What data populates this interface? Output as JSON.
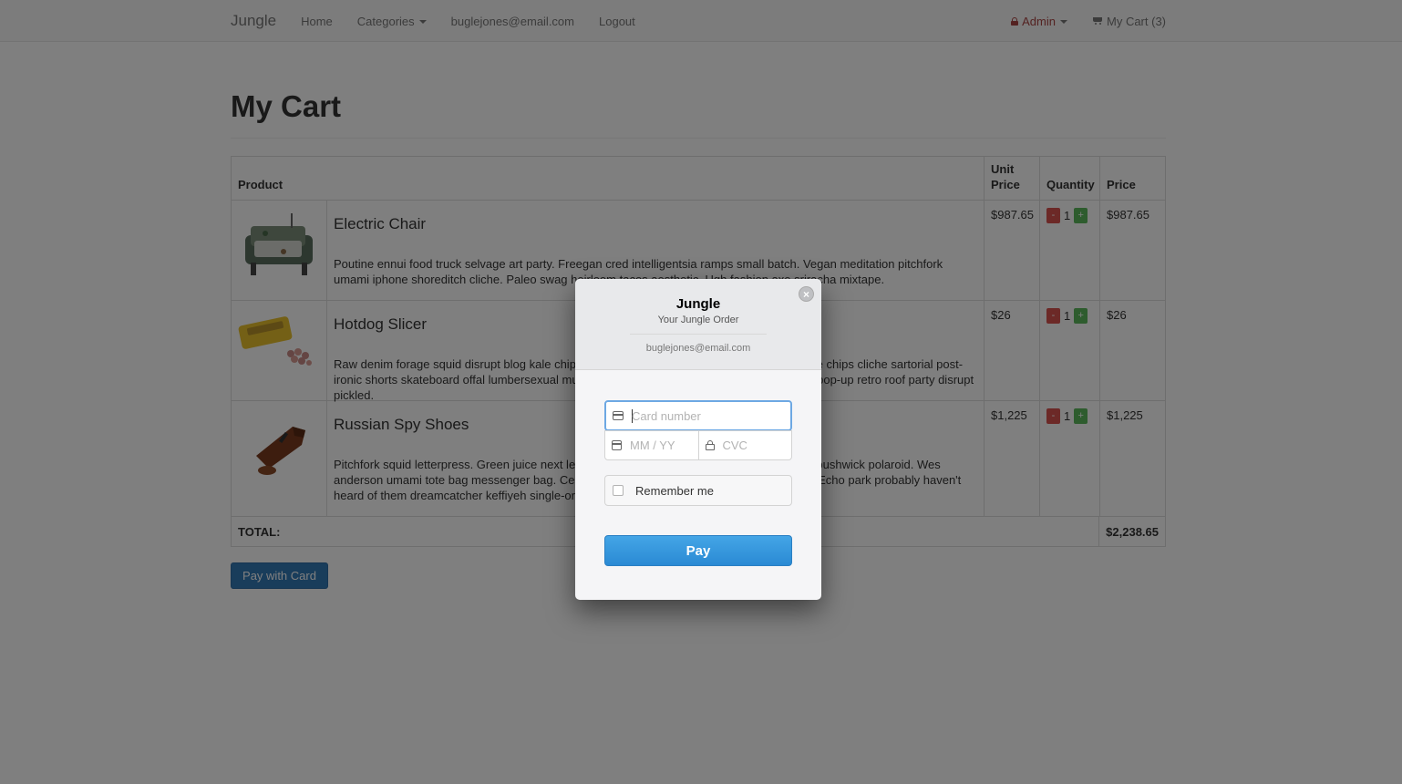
{
  "navbar": {
    "brand": "Jungle",
    "links": [
      "Home",
      "Categories",
      "buglejones@email.com",
      "Logout"
    ],
    "admin_label": "Admin",
    "cart_label": "My Cart (3)"
  },
  "page": {
    "title": "My Cart",
    "pay_card_label": "Pay with Card"
  },
  "table": {
    "headers": {
      "product": "Product",
      "unit_price": "Unit Price",
      "quantity": "Quantity",
      "price": "Price"
    },
    "rows": [
      {
        "name": "Electric Chair",
        "description": "Poutine ennui food truck selvage art party. Freegan cred intelligentsia ramps small batch. Vegan meditation pitchfork umami iphone shoreditch cliche. Paleo swag heirloom tacos aesthetic. Ugh fashion axe sriracha mixtape.",
        "unit_price": "$987.65",
        "qty_minus": "-",
        "quantity": "1",
        "qty_plus": "+",
        "price": "$987.65"
      },
      {
        "name": "Hotdog Slicer",
        "description": "Raw denim forage squid disrupt blog kale chips umami. Fanny pack tattooed blue bottle. Kale chips cliche sartorial post-ironic shorts skateboard offal lumbersexual muggle magic vhs. Food truck slow-carb brunch pop-up retro roof party disrupt pickled.",
        "unit_price": "$26",
        "qty_minus": "-",
        "quantity": "1",
        "qty_plus": "+",
        "price": "$26"
      },
      {
        "name": "Russian Spy Shoes",
        "description": "Pitchfork squid letterpress. Green juice next level organic direct trade chambray. Shoreditch bushwick polaroid. Wes anderson umami tote bag messenger bag. Celiac tacos stumptown hashtag kinfolk selvage. Echo park probably haven't heard of them dreamcatcher keffiyeh single-origin coffee shabby chic.",
        "unit_price": "$1,225",
        "qty_minus": "-",
        "quantity": "1",
        "qty_plus": "+",
        "price": "$1,225"
      }
    ],
    "total_label": "TOTAL:",
    "total_value": "$2,238.65"
  },
  "modal": {
    "title": "Jungle",
    "subtitle": "Your Jungle Order",
    "email": "buglejones@email.com",
    "close_glyph": "×",
    "card_placeholder": "Card number",
    "expiry_placeholder": "MM / YY",
    "cvc_placeholder": "CVC",
    "remember_label": "Remember me",
    "pay_label": "Pay"
  },
  "colors": {
    "primary": "#337ab7",
    "danger": "#d9534f",
    "success": "#5cb85c",
    "stripe_blue": "#3798dd"
  },
  "icons": [
    "lock-icon",
    "cart-icon",
    "card-icon",
    "calendar-icon",
    "lock-icon",
    "close-icon"
  ]
}
